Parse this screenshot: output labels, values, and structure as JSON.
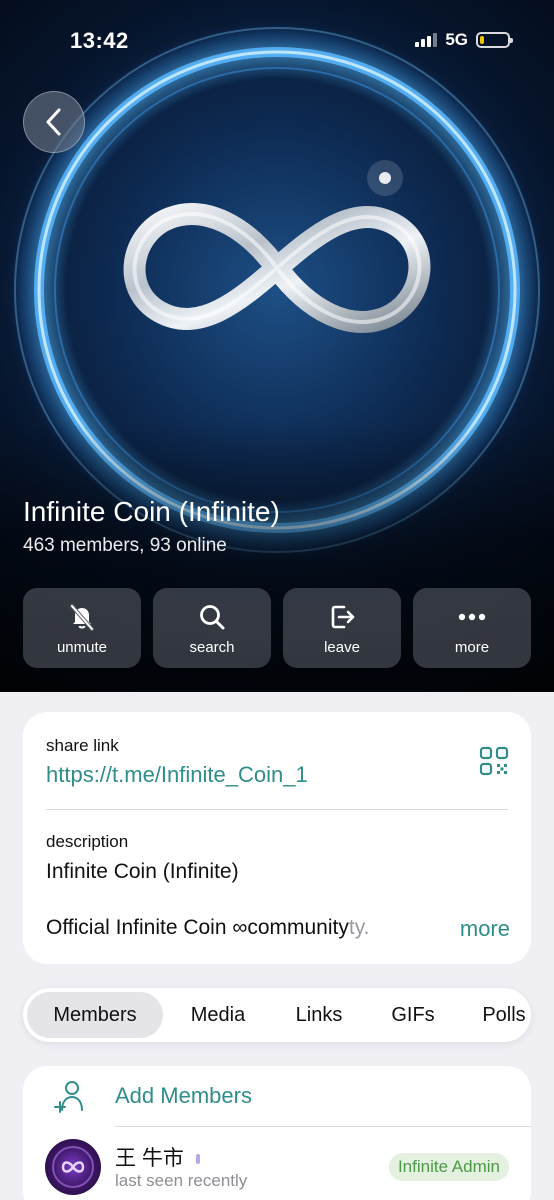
{
  "status_bar": {
    "time": "13:42",
    "network": "5G",
    "battery_icon": "battery-low-icon"
  },
  "header": {
    "title": "Infinite Coin (Infinite)",
    "subtitle": "463 members, 93 online",
    "back_icon": "chevron-left-icon"
  },
  "actions": [
    {
      "label": "unmute",
      "icon": "bell-slash-icon"
    },
    {
      "label": "search",
      "icon": "search-icon"
    },
    {
      "label": "leave",
      "icon": "leave-icon"
    },
    {
      "label": "more",
      "icon": "ellipsis-icon"
    }
  ],
  "info": {
    "share_label": "share link",
    "share_link": "https://t.me/Infinite_Coin_1",
    "qr_icon": "qr-code-icon",
    "description_label": "description",
    "description_line1": "Infinite Coin (Infinite)",
    "description_line2_main": "Official Infinite Coin ∞community",
    "description_line2_fade": "ty.",
    "more_label": "more"
  },
  "tabs": {
    "items": [
      "Members",
      "Media",
      "Links",
      "GIFs",
      "Polls"
    ],
    "active": "Members"
  },
  "members": {
    "add_label": "Add Members",
    "add_icon": "add-user-icon",
    "list": [
      {
        "name": "王 牛市",
        "status": "last seen recently",
        "badge": "Infinite Admin"
      }
    ]
  },
  "colors": {
    "accent": "#2f8d8a",
    "admin_badge_bg": "#e4f1e1",
    "admin_badge_text": "#4c9a45",
    "battery": "#f5c400"
  }
}
